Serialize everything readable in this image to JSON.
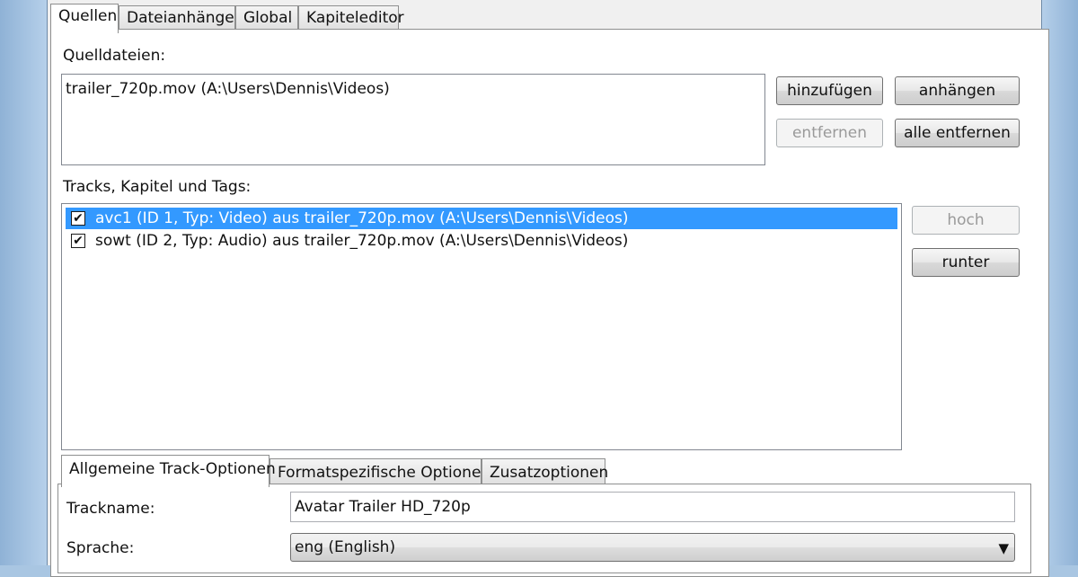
{
  "tabs": [
    "Quellen",
    "Dateianhänge",
    "Global",
    "Kapiteleditor"
  ],
  "sources": {
    "label": "Quelldateien:",
    "files": [
      "trailer_720p.mov (A:\\Users\\Dennis\\Videos)"
    ],
    "add_button": "hinzufügen",
    "append_button": "anhängen",
    "remove_button": "entfernen",
    "remove_all_button": "alle entfernen"
  },
  "tracks": {
    "label": "Tracks, Kapitel und Tags:",
    "items": [
      {
        "checked": true,
        "selected": true,
        "text": "avc1 (ID 1, Typ: Video) aus trailer_720p.mov (A:\\Users\\Dennis\\Videos)"
      },
      {
        "checked": true,
        "selected": false,
        "text": "sowt (ID 2, Typ: Audio) aus trailer_720p.mov (A:\\Users\\Dennis\\Videos)"
      }
    ],
    "up_button": "hoch",
    "down_button": "runter"
  },
  "subtabs": [
    "Allgemeine Track-Optionen",
    "Formatspezifische Optionen",
    "Zusatzoptionen"
  ],
  "options": {
    "trackname_label": "Trackname:",
    "trackname_value": "Avatar Trailer HD_720p",
    "language_label": "Sprache:",
    "language_value": "eng (English)"
  },
  "colors": {
    "selection": "#3399ff",
    "panel": "#f0f0f0"
  },
  "icons": {
    "checkbox": "check-mark",
    "combo": "triangle-down"
  }
}
